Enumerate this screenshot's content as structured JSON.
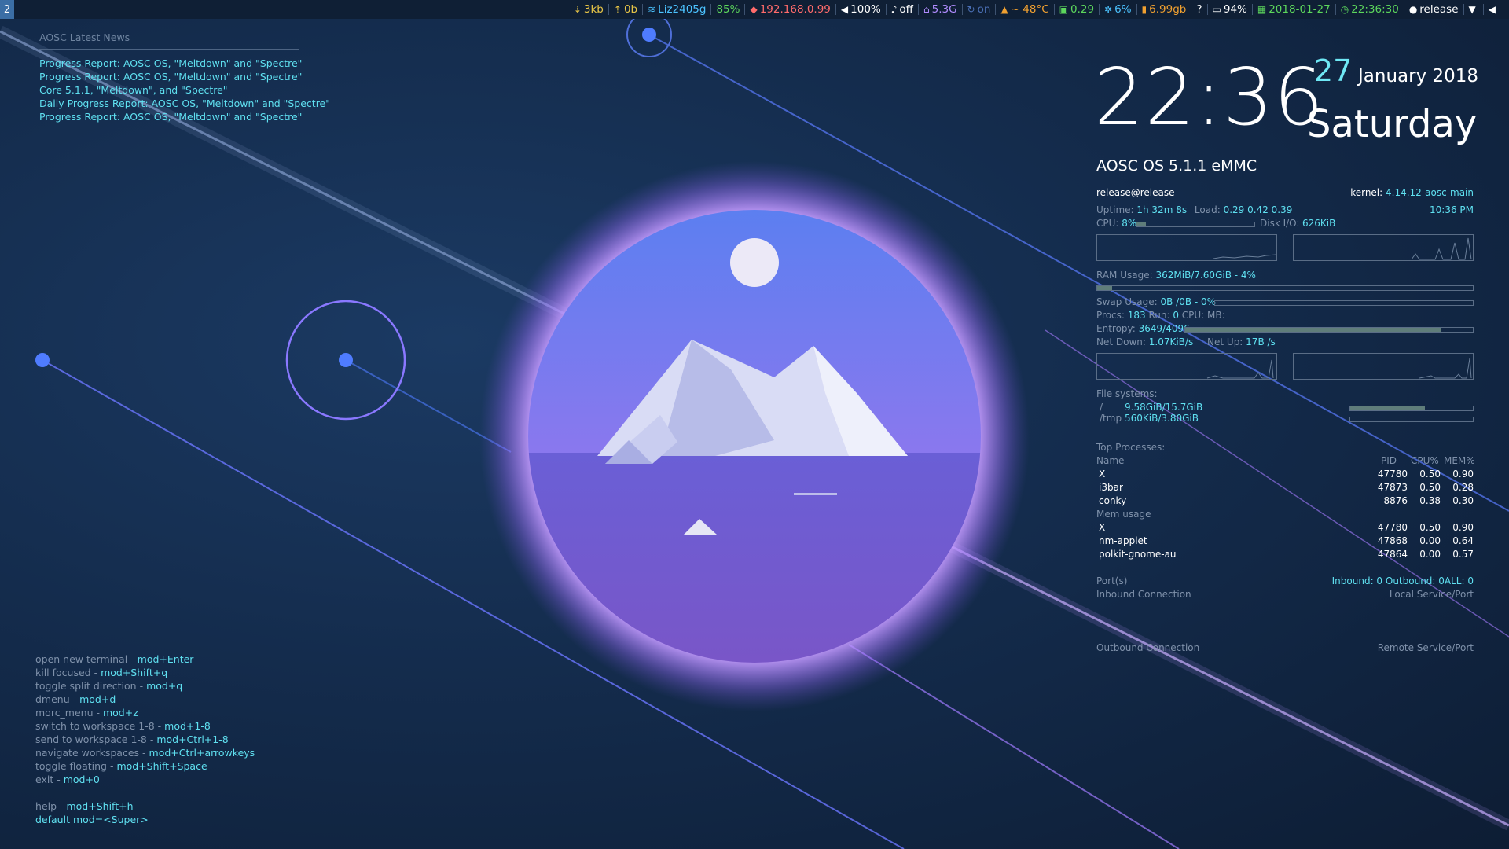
{
  "topbar": {
    "workspace": "2",
    "items": [
      {
        "icon": "download-icon",
        "text": "3kb",
        "color": "#e8c547"
      },
      {
        "icon": "upload-icon",
        "text": "0b",
        "color": "#e8c547"
      },
      {
        "icon": "wifi-icon",
        "text": "Liz2405g",
        "color": "#4cc3ff"
      },
      {
        "icon": "",
        "text": "85%",
        "color": "#5cd65c"
      },
      {
        "icon": "tag-icon",
        "text": "192.168.0.99",
        "color": "#ff6b6b"
      },
      {
        "icon": "speaker-icon",
        "text": "100%",
        "color": "#ffffff"
      },
      {
        "icon": "microphone-icon",
        "text": "off",
        "color": "#ffffff"
      },
      {
        "icon": "home-icon",
        "text": "5.3G",
        "color": "#b28cff"
      },
      {
        "icon": "sync-icon",
        "text": "on",
        "color": "#4a6fb5"
      },
      {
        "icon": "temperature-icon",
        "text": "~ 48°C",
        "color": "#f0a030"
      },
      {
        "icon": "cpu-icon",
        "text": "0.29",
        "color": "#5cd65c"
      },
      {
        "icon": "gear-icon",
        "text": "6%",
        "color": "#4cc3ff"
      },
      {
        "icon": "memory-icon",
        "text": "6.99gb",
        "color": "#f0a030"
      },
      {
        "icon": "",
        "text": "?",
        "color": "#ffffff"
      },
      {
        "icon": "battery-icon",
        "text": "94%",
        "color": "#ffffff"
      },
      {
        "icon": "calendar-icon",
        "text": "2018-01-27",
        "color": "#5cd65c"
      },
      {
        "icon": "clock-icon",
        "text": "22:36:30",
        "color": "#5cd65c"
      },
      {
        "icon": "user-icon",
        "text": "release",
        "color": "#ffffff"
      },
      {
        "icon": "wifi-tray-icon",
        "text": "",
        "color": "#ffffff"
      },
      {
        "icon": "volume-tray-icon",
        "text": "",
        "color": "#ffffff"
      }
    ]
  },
  "news": {
    "title": "AOSC Latest News",
    "items": [
      "Progress Report: AOSC OS, \"Meltdown\" and \"Spectre\"",
      "Progress Report: AOSC OS, \"Meltdown\" and \"Spectre\"",
      "Core 5.1.1, \"Meltdown\", and \"Spectre\"",
      "Daily Progress Report: AOSC OS, \"Meltdown\" and \"Spectre\"",
      "Progress Report: AOSC OS, \"Meltdown\" and \"Spectre\""
    ]
  },
  "keybindings": [
    {
      "desc": "open new terminal - ",
      "key": "mod+Enter"
    },
    {
      "desc": "kill focused - ",
      "key": "mod+Shift+q"
    },
    {
      "desc": "toggle split direction - ",
      "key": "mod+q"
    },
    {
      "desc": "dmenu - ",
      "key": "mod+d"
    },
    {
      "desc": "morc_menu - ",
      "key": "mod+z"
    },
    {
      "desc": "switch to workspace 1-8 - ",
      "key": "mod+1-8"
    },
    {
      "desc": "send to workspace 1-8 - ",
      "key": "mod+Ctrl+1-8"
    },
    {
      "desc": "navigate workspaces - ",
      "key": "mod+Ctrl+arrowkeys"
    },
    {
      "desc": "toggle floating - ",
      "key": "mod+Shift+Space"
    },
    {
      "desc": "exit - ",
      "key": "mod+0"
    }
  ],
  "help": {
    "desc": "help - ",
    "key": "mod+Shift+h",
    "default": "default mod=<Super>"
  },
  "clock": {
    "time": "22:36",
    "day": "27",
    "month_year": "January 2018",
    "weekday": "Saturday"
  },
  "conky": {
    "os_name": "AOSC OS 5.1.1 eMMC",
    "user_host": "release@release",
    "kernel_label": "kernel: ",
    "kernel_value": "4.14.12-aosc-main",
    "uptime_label": "Uptime: ",
    "uptime_value": "1h 32m 8s",
    "load_label": "Load: ",
    "load_value": "0.29 0.42 0.39",
    "time12": "10:36 PM",
    "cpu_label": "CPU: ",
    "cpu_value": "8%",
    "cpu_fraction": 0.08,
    "diskio_label": "Disk I/O: ",
    "diskio_value": "626KiB",
    "ram_label": "RAM Usage: ",
    "ram_value": "362MiB/7.60GiB - 4%",
    "ram_fraction": 0.04,
    "swap_label": "Swap Usage: ",
    "swap_value": "0B  /0B   - 0%",
    "swap_fraction": 0,
    "procs_label": "Procs: ",
    "procs_value": "183",
    "run_label": " Run: ",
    "run_value": "0",
    "cpu_mb_label": " CPU:   MB:",
    "entropy_label": "Entropy: ",
    "entropy_value": "3649/4096",
    "entropy_fraction": 0.89,
    "netdown_label": "Net Down: ",
    "netdown_value": "1.07KiB/s",
    "netup_label": "Net Up: ",
    "netup_value": "17B  /s",
    "fs_title": "File systems:",
    "filesystems": [
      {
        "mount": "/",
        "usage": "9.58GiB/15.7GiB",
        "fraction": 0.61
      },
      {
        "mount": "/tmp",
        "usage": "560KiB/3.80GiB",
        "fraction": 0.0
      }
    ],
    "top_title": "Top Processes:",
    "proc_headers": {
      "name": "Name",
      "pid": "PID",
      "cpu": "CPU%",
      "mem": "MEM%"
    },
    "top_cpu": [
      {
        "name": "X",
        "pid": "47780",
        "cpu": "0.50",
        "mem": "0.90"
      },
      {
        "name": "i3bar",
        "pid": "47873",
        "cpu": "0.50",
        "mem": "0.28"
      },
      {
        "name": "conky",
        "pid": "8876",
        "cpu": "0.38",
        "mem": "0.30"
      }
    ],
    "mem_title": "Mem usage",
    "top_mem": [
      {
        "name": "X",
        "pid": "47780",
        "cpu": "0.50",
        "mem": "0.90"
      },
      {
        "name": "nm-applet",
        "pid": "47868",
        "cpu": "0.00",
        "mem": "0.64"
      },
      {
        "name": "polkit-gnome-au",
        "pid": "47864",
        "cpu": "0.00",
        "mem": "0.57"
      }
    ],
    "ports_label": "Port(s)",
    "ports_value": "Inbound: 0  Outbound: 0ALL: 0",
    "inbound_label": "Inbound Connection",
    "local_label": "Local Service/Port",
    "outbound_label": "Outbound Connection",
    "remote_label": "Remote Service/Port"
  },
  "colors": {
    "accent_cyan": "#5fe0f0",
    "bar_bg": "#0f1f35",
    "workspace": "#3b6ea5"
  }
}
